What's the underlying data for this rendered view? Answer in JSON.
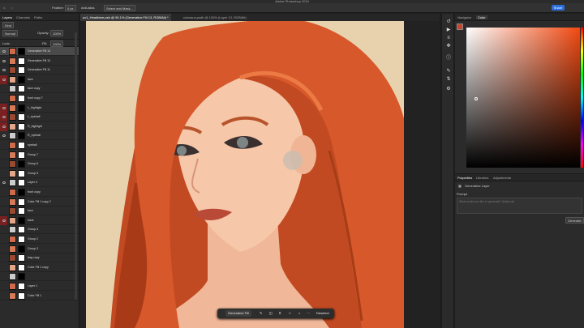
{
  "app": {
    "title": "Adobe Photoshop 2024"
  },
  "options": {
    "feather_label": "Feather:",
    "feather_value": "0 px",
    "antialias": "Anti-alias",
    "select_mask": "Select and Mask...",
    "share": "Share"
  },
  "layers_panel": {
    "tabs": [
      "Layers",
      "Channels",
      "Paths"
    ],
    "kind": "Kind",
    "mode": "Normal",
    "opacity_label": "Opacity:",
    "opacity_value": "100%",
    "lock_label": "Lock:",
    "fill_label": "Fill:",
    "fill_value": "100%",
    "layers": [
      {
        "name": "Generative Fill 13",
        "visible": true,
        "selected": true
      },
      {
        "name": "Generative Fill 12",
        "visible": true
      },
      {
        "name": "Generative Fill 11",
        "visible": true
      },
      {
        "name": "face",
        "visible": true,
        "red": true
      },
      {
        "name": "face copy",
        "visible": false
      },
      {
        "name": "front copy 7",
        "visible": false
      },
      {
        "name": "L_highlight",
        "visible": true,
        "red": true
      },
      {
        "name": "L_eyeball",
        "visible": true,
        "red": true
      },
      {
        "name": "R_highlight",
        "visible": true,
        "red": true
      },
      {
        "name": "R_eyeball",
        "visible": true
      },
      {
        "name": "eyeball",
        "visible": false
      },
      {
        "name": "Group 7",
        "visible": false
      },
      {
        "name": "Group 6",
        "visible": false
      },
      {
        "name": "Group 5",
        "visible": false
      },
      {
        "name": "Layer 4",
        "visible": true
      },
      {
        "name": "front copy",
        "visible": false
      },
      {
        "name": "Color Fill 1 copy 2",
        "visible": false
      },
      {
        "name": "face",
        "visible": false
      },
      {
        "name": "back",
        "visible": true,
        "red": true
      },
      {
        "name": "Group 4",
        "visible": false
      },
      {
        "name": "Group 2",
        "visible": false
      },
      {
        "name": "Group 3",
        "visible": false
      },
      {
        "name": "bag copy",
        "visible": false
      },
      {
        "name": "Color Fill 1 copy",
        "visible": false
      },
      {
        "name": "",
        "visible": false
      },
      {
        "name": "Layer 1",
        "visible": false
      },
      {
        "name": "Color Fill 1",
        "visible": false
      }
    ]
  },
  "documents": {
    "tabs": [
      {
        "label": "oc1_Headfarm.psb @ 90.1% (Generative Fill 13, RGB/8#) *",
        "active": true
      },
      {
        "label": "colossus.psdb @ 100% (Layer 13, RGB/8#)",
        "active": false
      }
    ]
  },
  "right_panel": {
    "tabs": [
      "Navigator",
      "Color"
    ],
    "color_hex": "#c7452a",
    "props_tabs": [
      "Properties",
      "Libraries",
      "Adjustments"
    ],
    "layer_type": "Generative Layer",
    "prompt_label": "Prompt",
    "prompt_placeholder": "What would you like to generate? (Optional)",
    "generate": "Generate"
  },
  "context_bar": {
    "generative_fill": "Generative Fill",
    "deselect": "Deselect"
  }
}
